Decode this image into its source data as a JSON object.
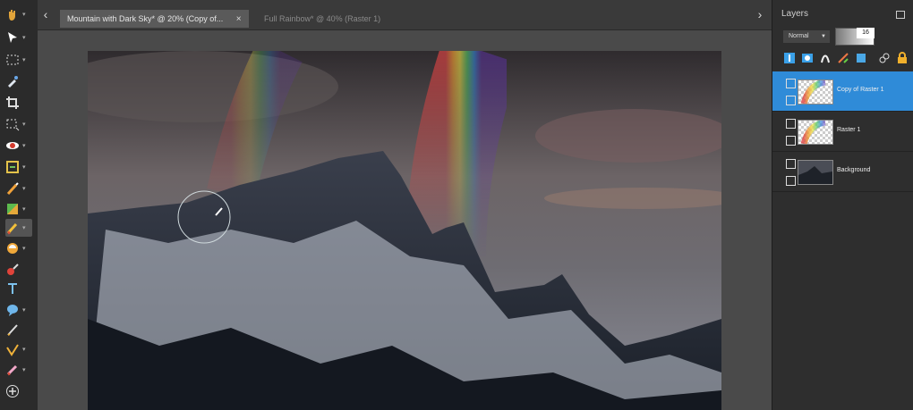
{
  "tabs": [
    {
      "label": "Mountain with Dark Sky* @  20% (Copy of...",
      "active": true
    },
    {
      "label": "Full Rainbow* @  40% (Raster 1)",
      "active": false
    }
  ],
  "tab_close": "×",
  "nav": {
    "left": "‹",
    "right": "›"
  },
  "tools": [
    {
      "icon": "pan-hand-icon"
    },
    {
      "icon": "pick-arrow-icon"
    },
    {
      "icon": "selection-rect-icon"
    },
    {
      "icon": "dropper-icon"
    },
    {
      "icon": "crop-icon"
    },
    {
      "icon": "move-marquee-icon"
    },
    {
      "icon": "red-eye-icon"
    },
    {
      "icon": "object-remover-icon"
    },
    {
      "icon": "paint-brush-icon"
    },
    {
      "icon": "color-replacer-icon"
    },
    {
      "icon": "clone-brush-icon"
    },
    {
      "icon": "eraser-icon"
    },
    {
      "icon": "dodge-burn-icon"
    },
    {
      "icon": "text-icon"
    },
    {
      "icon": "shape-icon"
    },
    {
      "icon": "pen-icon"
    },
    {
      "icon": "warp-brush-icon"
    },
    {
      "icon": "smudge-icon"
    },
    {
      "icon": "add-tool-icon"
    }
  ],
  "layers_panel": {
    "title": "Layers",
    "blend_mode": "Normal",
    "opacity": "16",
    "layers": [
      {
        "name": "Copy of Raster 1",
        "selected": true,
        "thumb": "rainbow"
      },
      {
        "name": "Raster 1",
        "selected": false,
        "thumb": "rainbow"
      },
      {
        "name": "Background",
        "selected": false,
        "thumb": "photo"
      }
    ]
  },
  "colors": {
    "panel_bg": "#2e2e2e",
    "selected_layer": "#2f8bd8",
    "workspace": "#4a4a4a"
  }
}
